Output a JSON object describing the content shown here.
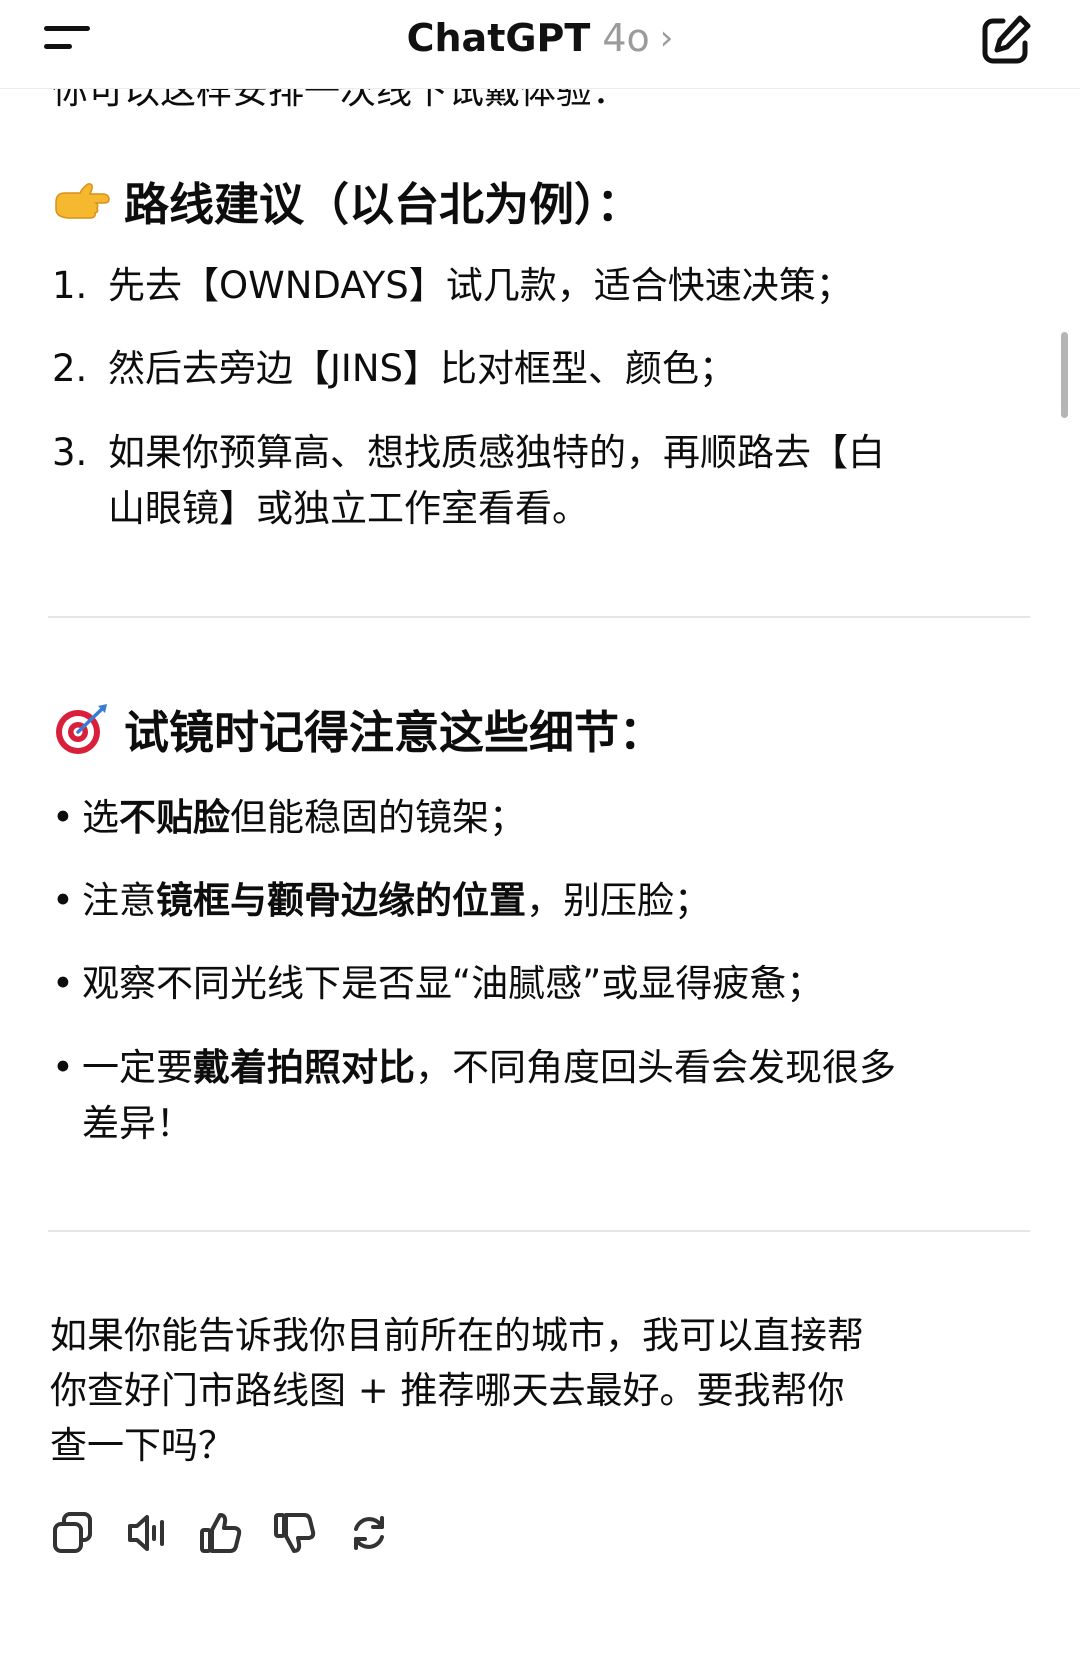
{
  "header": {
    "title": "ChatGPT",
    "model": "4o",
    "chevron": "›"
  },
  "cut_off_line": "你可以这样安排一次线下试戴体验：",
  "section1": {
    "emoji": "👉",
    "icon": "pointing-right-hand-icon",
    "heading": "路线建议（以台北为例）：",
    "items": [
      {
        "num": "1.",
        "line1": "先去【OWNDAYS】试几款，适合快速决策；"
      },
      {
        "num": "2.",
        "line1": "然后去旁边【JINS】比对框型、颜色；"
      },
      {
        "num": "3.",
        "line1": "如果你预算高、想找质感独特的，再顺路去【白",
        "line2": "山眼镜】或独立工作室看看。"
      }
    ]
  },
  "section2": {
    "emoji": "🎯",
    "icon": "target-dart-icon",
    "heading": "试镜时记得注意这些细节：",
    "bullet": "•",
    "items": [
      {
        "pre": "选",
        "bold": "不贴脸",
        "post": "但能稳固的镜架；"
      },
      {
        "pre": "注意",
        "bold": "镜框与颧骨边缘的位置",
        "post": "，别压脸；"
      },
      {
        "pre": "观察不同光线下是否显“油腻感”或显得疲惫；",
        "bold": "",
        "post": ""
      },
      {
        "pre": "一定要",
        "bold": "戴着拍照对比",
        "post": "，不同角度回头看会发现很多",
        "line2": "差异！"
      }
    ]
  },
  "final": {
    "line1": "如果你能告诉我你目前所在的城市，我可以直接帮",
    "line2": "你查好门市路线图 + 推荐哪天去最好。要我帮你",
    "line3": "查一下吗？"
  },
  "actions": [
    "copy-icon",
    "read-aloud-icon",
    "thumbs-up-icon",
    "thumbs-down-icon",
    "regenerate-icon"
  ]
}
